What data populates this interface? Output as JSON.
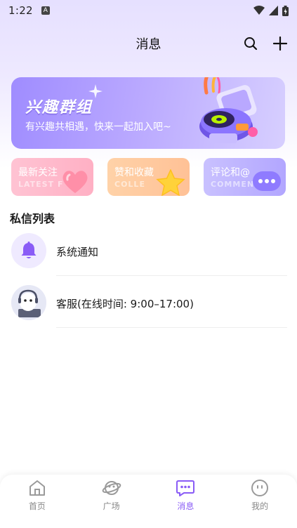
{
  "status_bar": {
    "time": "1:22",
    "a_badge": "A"
  },
  "header": {
    "title": "消息",
    "search_icon": "search-icon",
    "add_icon": "plus-icon"
  },
  "group_banner": {
    "title": "兴趣群组",
    "subtitle": "有兴趣共相遇，快来一起加入吧~"
  },
  "quick_actions": [
    {
      "label": "最新关注",
      "sub": "LATEST F",
      "icon": "heart-icon"
    },
    {
      "label": "赞和收藏",
      "sub": "COLLE",
      "icon": "star-icon"
    },
    {
      "label": "评论和@",
      "sub": "COMMEN",
      "icon": "chat-bubble-icon"
    }
  ],
  "private_messages": {
    "title": "私信列表",
    "items": [
      {
        "name": "系统通知",
        "icon": "bell-icon"
      },
      {
        "name": "客服(在线时间: 9:00–17:00)",
        "icon": "support-avatar"
      }
    ]
  },
  "tabs": [
    {
      "label": "首页",
      "icon": "home-icon"
    },
    {
      "label": "广场",
      "icon": "planet-icon"
    },
    {
      "label": "消息",
      "icon": "message-icon"
    },
    {
      "label": "我的",
      "icon": "face-icon"
    }
  ],
  "colors": {
    "accent": "#8a5cf6",
    "banner": "#a995ff",
    "follow": "#ffb6c8",
    "like": "#ffc99f",
    "comment": "#b9aeff"
  }
}
